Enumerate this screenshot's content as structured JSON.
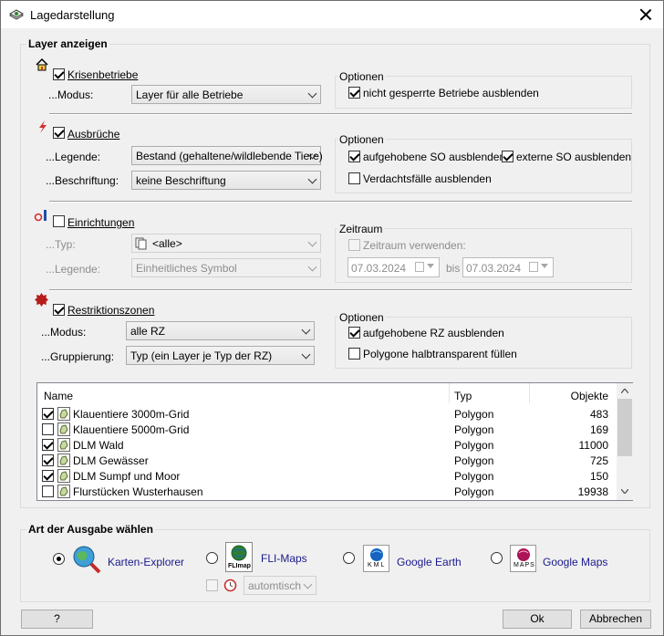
{
  "window": {
    "title": "Lagedarstellung"
  },
  "layer_group": {
    "label": "Layer anzeigen",
    "krisenbetriebe": {
      "title": "Krisenbetriebe",
      "modus_label": "...Modus:",
      "modus_value": "Layer für alle Betriebe",
      "options_title": "Optionen",
      "opt1": "nicht gesperrte Betriebe ausblenden"
    },
    "ausbrueche": {
      "title": "Ausbrüche",
      "legende_label": "...Legende:",
      "legende_value": "Bestand (gehaltene/wildlebende Tiere)",
      "beschriftung_label": "...Beschriftung:",
      "beschriftung_value": "keine Beschriftung",
      "options_title": "Optionen",
      "opt1": "aufgehobene SO ausblenden",
      "opt2": "externe SO ausblenden",
      "opt3": "Verdachtsfälle ausblenden"
    },
    "einrichtungen": {
      "title": "Einrichtungen",
      "typ_label": "...Typ:",
      "typ_value": "<alle>",
      "legende_label": "...Legende:",
      "legende_value": "Einheitliches Symbol",
      "zeitraum_title": "Zeitraum",
      "zeitraum_cb": "Zeitraum verwenden:",
      "date_from": "07.03.2024",
      "bis": "bis",
      "date_to": "07.03.2024"
    },
    "restriktionszonen": {
      "title": "Restriktionszonen",
      "modus_label": "...Modus:",
      "modus_value": "alle RZ",
      "gruppierung_label": "...Gruppierung:",
      "gruppierung_value": "Typ  (ein Layer je Typ der RZ)",
      "options_title": "Optionen",
      "opt1": "aufgehobene RZ ausblenden",
      "opt2": "Polygone halbtransparent füllen"
    },
    "table": {
      "headers": [
        "Name",
        "Typ",
        "Objekte"
      ],
      "rows": [
        {
          "name": "Klauentiere 3000m-Grid",
          "typ": "Polygon",
          "objekte": "483",
          "checked": true
        },
        {
          "name": "Klauentiere 5000m-Grid",
          "typ": "Polygon",
          "objekte": "169",
          "checked": false
        },
        {
          "name": "DLM Wald",
          "typ": "Polygon",
          "objekte": "11000",
          "checked": true
        },
        {
          "name": "DLM Gewässer",
          "typ": "Polygon",
          "objekte": "725",
          "checked": true
        },
        {
          "name": "DLM Sumpf und Moor",
          "typ": "Polygon",
          "objekte": "150",
          "checked": true
        },
        {
          "name": "Flurstücken Wusterhausen",
          "typ": "Polygon",
          "objekte": "19938",
          "checked": false
        }
      ]
    }
  },
  "output_group": {
    "label": "Art der Ausgabe wählen",
    "options": [
      "Karten-Explorer",
      "FLI-Maps",
      "Google Earth",
      "Google Maps"
    ],
    "selected": "Karten-Explorer",
    "fli_badge": "FLImap",
    "kml_badge": "KML",
    "maps_badge": "MAPS",
    "auto_value": "automtisch"
  },
  "buttons": {
    "help": "?",
    "ok": "Ok",
    "cancel": "Abbrechen"
  },
  "colors": {
    "link": "#1a1a8c",
    "group_border": "#dcdcdc"
  }
}
